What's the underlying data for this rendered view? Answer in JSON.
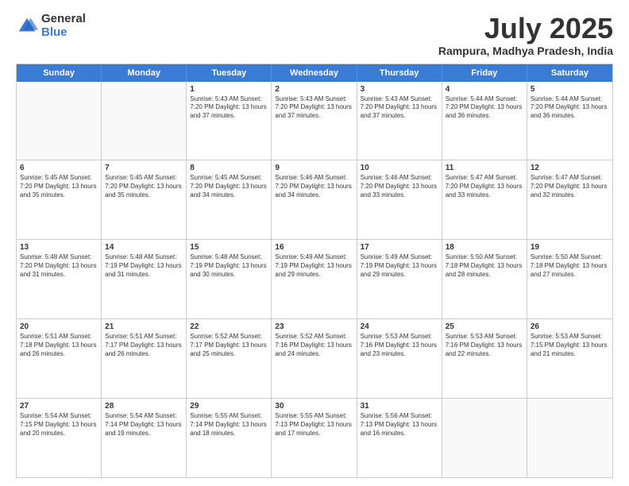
{
  "logo": {
    "general": "General",
    "blue": "Blue"
  },
  "title": "July 2025",
  "subtitle": "Rampura, Madhya Pradesh, India",
  "header_days": [
    "Sunday",
    "Monday",
    "Tuesday",
    "Wednesday",
    "Thursday",
    "Friday",
    "Saturday"
  ],
  "rows": [
    [
      {
        "day": "",
        "empty": true
      },
      {
        "day": "",
        "empty": true
      },
      {
        "day": "1",
        "text": "Sunrise: 5:43 AM\nSunset: 7:20 PM\nDaylight: 13 hours and 37 minutes."
      },
      {
        "day": "2",
        "text": "Sunrise: 5:43 AM\nSunset: 7:20 PM\nDaylight: 13 hours and 37 minutes."
      },
      {
        "day": "3",
        "text": "Sunrise: 5:43 AM\nSunset: 7:20 PM\nDaylight: 13 hours and 37 minutes."
      },
      {
        "day": "4",
        "text": "Sunrise: 5:44 AM\nSunset: 7:20 PM\nDaylight: 13 hours and 36 minutes."
      },
      {
        "day": "5",
        "text": "Sunrise: 5:44 AM\nSunset: 7:20 PM\nDaylight: 13 hours and 36 minutes."
      }
    ],
    [
      {
        "day": "6",
        "text": "Sunrise: 5:45 AM\nSunset: 7:20 PM\nDaylight: 13 hours and 35 minutes."
      },
      {
        "day": "7",
        "text": "Sunrise: 5:45 AM\nSunset: 7:20 PM\nDaylight: 13 hours and 35 minutes."
      },
      {
        "day": "8",
        "text": "Sunrise: 5:45 AM\nSunset: 7:20 PM\nDaylight: 13 hours and 34 minutes."
      },
      {
        "day": "9",
        "text": "Sunrise: 5:46 AM\nSunset: 7:20 PM\nDaylight: 13 hours and 34 minutes."
      },
      {
        "day": "10",
        "text": "Sunrise: 5:46 AM\nSunset: 7:20 PM\nDaylight: 13 hours and 33 minutes."
      },
      {
        "day": "11",
        "text": "Sunrise: 5:47 AM\nSunset: 7:20 PM\nDaylight: 13 hours and 33 minutes."
      },
      {
        "day": "12",
        "text": "Sunrise: 5:47 AM\nSunset: 7:20 PM\nDaylight: 13 hours and 32 minutes."
      }
    ],
    [
      {
        "day": "13",
        "text": "Sunrise: 5:48 AM\nSunset: 7:20 PM\nDaylight: 13 hours and 31 minutes."
      },
      {
        "day": "14",
        "text": "Sunrise: 5:48 AM\nSunset: 7:19 PM\nDaylight: 13 hours and 31 minutes."
      },
      {
        "day": "15",
        "text": "Sunrise: 5:48 AM\nSunset: 7:19 PM\nDaylight: 13 hours and 30 minutes."
      },
      {
        "day": "16",
        "text": "Sunrise: 5:49 AM\nSunset: 7:19 PM\nDaylight: 13 hours and 29 minutes."
      },
      {
        "day": "17",
        "text": "Sunrise: 5:49 AM\nSunset: 7:19 PM\nDaylight: 13 hours and 29 minutes."
      },
      {
        "day": "18",
        "text": "Sunrise: 5:50 AM\nSunset: 7:18 PM\nDaylight: 13 hours and 28 minutes."
      },
      {
        "day": "19",
        "text": "Sunrise: 5:50 AM\nSunset: 7:18 PM\nDaylight: 13 hours and 27 minutes."
      }
    ],
    [
      {
        "day": "20",
        "text": "Sunrise: 5:51 AM\nSunset: 7:18 PM\nDaylight: 13 hours and 26 minutes."
      },
      {
        "day": "21",
        "text": "Sunrise: 5:51 AM\nSunset: 7:17 PM\nDaylight: 13 hours and 26 minutes."
      },
      {
        "day": "22",
        "text": "Sunrise: 5:52 AM\nSunset: 7:17 PM\nDaylight: 13 hours and 25 minutes."
      },
      {
        "day": "23",
        "text": "Sunrise: 5:52 AM\nSunset: 7:16 PM\nDaylight: 13 hours and 24 minutes."
      },
      {
        "day": "24",
        "text": "Sunrise: 5:53 AM\nSunset: 7:16 PM\nDaylight: 13 hours and 23 minutes."
      },
      {
        "day": "25",
        "text": "Sunrise: 5:53 AM\nSunset: 7:16 PM\nDaylight: 13 hours and 22 minutes."
      },
      {
        "day": "26",
        "text": "Sunrise: 5:53 AM\nSunset: 7:15 PM\nDaylight: 13 hours and 21 minutes."
      }
    ],
    [
      {
        "day": "27",
        "text": "Sunrise: 5:54 AM\nSunset: 7:15 PM\nDaylight: 13 hours and 20 minutes."
      },
      {
        "day": "28",
        "text": "Sunrise: 5:54 AM\nSunset: 7:14 PM\nDaylight: 13 hours and 19 minutes."
      },
      {
        "day": "29",
        "text": "Sunrise: 5:55 AM\nSunset: 7:14 PM\nDaylight: 13 hours and 18 minutes."
      },
      {
        "day": "30",
        "text": "Sunrise: 5:55 AM\nSunset: 7:13 PM\nDaylight: 13 hours and 17 minutes."
      },
      {
        "day": "31",
        "text": "Sunrise: 5:56 AM\nSunset: 7:13 PM\nDaylight: 13 hours and 16 minutes."
      },
      {
        "day": "",
        "empty": true
      },
      {
        "day": "",
        "empty": true
      }
    ]
  ]
}
